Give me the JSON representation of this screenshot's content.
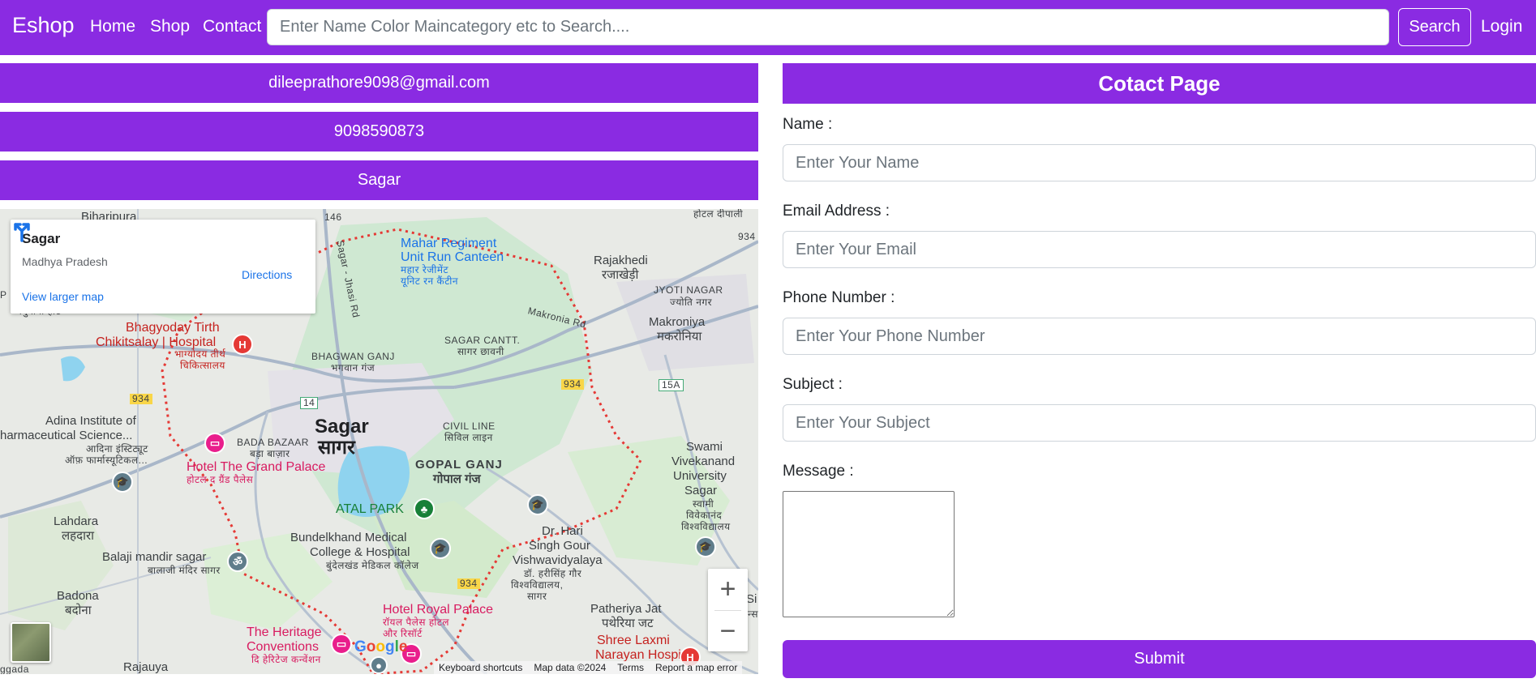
{
  "nav": {
    "brand": "Eshop",
    "links": [
      "Home",
      "Shop",
      "Contact"
    ],
    "search_placeholder": "Enter Name Color Maincategory etc to Search....",
    "search_button": "Search",
    "login": "Login"
  },
  "info": {
    "email": "dileeprathore9098@gmail.com",
    "phone": "9098590873",
    "city": "Sagar"
  },
  "map": {
    "card": {
      "title": "Sagar",
      "subtitle": "Madhya Pradesh",
      "directions": "Directions",
      "larger_map": "View larger map"
    },
    "labels": {
      "sagar_en": "Sagar",
      "sagar_hi": "सागर",
      "biharipura": "Biharipura",
      "mahar_1": "Mahar Regiment",
      "mahar_2": "Unit Run Canteen",
      "mahar_hi_1": "महार रेजीमेंट",
      "mahar_hi_2": "यूनिट रन कैंटीन",
      "rajakhedi": "Rajakhedi",
      "rajakhedi_hi": "रजाखेड़ी",
      "jyoti_nagar": "JYOTI NAGAR",
      "jyoti_nagar_hi": "ज्योति नगर",
      "makroniya": "Makroniya",
      "makroniya_hi": "मकरोनिया",
      "makronia_rd": "Makronia Rd",
      "sagar_jhasi_rd": "Sagar - Jhasi Rd",
      "bhagyoday_1": "Bhagyoday Tirth",
      "bhagyoday_2": "Chikitsalay | Hospital",
      "bhagyoday_hi_1": "भाग्योदय तीर्थ",
      "bhagyoday_hi_2": "चिकित्सालय",
      "bhagwan_ganj": "BHAGWAN GANJ",
      "bhagwan_ganj_hi": "भगवान गंज",
      "sagar_cantt": "SAGAR CANTT.",
      "sagar_cantt_hi": "सागर छावनी",
      "adina_1": "Adina Institute of",
      "adina_2": "harmaceutical Science...",
      "adina_hi_1": "आदिना इंस्टिट्यूट",
      "adina_hi_2": "ऑफ़ फार्मास्यूटिकल...",
      "bada_bazaar": "BADA BAZAAR",
      "bada_bazaar_hi": "बड़ा बाज़ार",
      "civil_line": "CIVIL LINE",
      "civil_line_hi": "सिविल लाइन",
      "grand_palace": "Hotel The Grand Palace",
      "grand_palace_hi": "होटल द ग्रैंड पैलेस",
      "gopal_ganj": "GOPAL GANJ",
      "gopal_ganj_hi": "गोपाल गंज",
      "swami_1": "Swami",
      "swami_2": "Vivekanand",
      "swami_3": "University",
      "swami_4": "Sagar",
      "swami_hi_1": "स्वामी",
      "swami_hi_2": "विवेकानंद",
      "swami_hi_3": "विश्वविद्यालय",
      "atal_park": "ATAL PARK",
      "lahdara": "Lahdara",
      "lahdara_hi": "लहदारा",
      "bundelkhand_1": "Bundelkhand Medical",
      "bundelkhand_2": "College & Hospital",
      "bundelkhand_hi": "बुंदेलखंड मेडिकल कॉलेज",
      "hari_1": "Dr. Hari",
      "hari_2": "Singh Gour",
      "hari_3": "Vishwavidyalaya",
      "hari_hi_1": "डॉ. हरीसिंह गौर",
      "hari_hi_2": "विश्वविद्यालय,",
      "hari_hi_3": "सागर",
      "balaji": "Balaji mandir sagar",
      "balaji_hi": "बालाजी मंदिर सागर",
      "badona": "Badona",
      "badona_hi": "बदोना",
      "royal_palace": "Hotel Royal Palace",
      "royal_palace_hi_1": "रॉयल पैलेस होटल",
      "royal_palace_hi_2": "और रिसॉर्ट",
      "patheriya": "Patheriya Jat",
      "patheriya_hi": "पथेरिया जट",
      "heritage_1": "The Heritage",
      "heritage_2": "Conventions",
      "heritage_hi": "दि हेरिटेज कन्वेंशन",
      "shree_laxmi_1": "Shree Laxmi",
      "shree_laxmi_2": "Narayan Hospital",
      "rajauya": "Rajauya",
      "paduaya": "पदुवावा हाट",
      "hotel_top": "होटल दीपाली",
      "aggada": "ggada",
      "si": "Si",
      "ns": "न्स",
      "p": "P"
    },
    "highways": [
      "146",
      "934",
      "934",
      "934",
      "15A",
      "14",
      "934"
    ],
    "attribution": {
      "shortcuts": "Keyboard shortcuts",
      "data": "Map data ©2024",
      "terms": "Terms",
      "report": "Report a map error"
    },
    "google": "Google"
  },
  "form": {
    "title": "Cotact Page",
    "name_label": "Name :",
    "name_placeholder": "Enter Your Name",
    "email_label": "Email Address :",
    "email_placeholder": "Enter Your Email",
    "phone_label": "Phone Number :",
    "phone_placeholder": "Enter Your Phone Number",
    "subject_label": "Subject :",
    "subject_placeholder": "Enter Your Subject",
    "message_label": "Message :",
    "submit": "Submit"
  },
  "colors": {
    "brand_purple": "#8a2be2",
    "map_link_blue": "#1a73e8"
  }
}
